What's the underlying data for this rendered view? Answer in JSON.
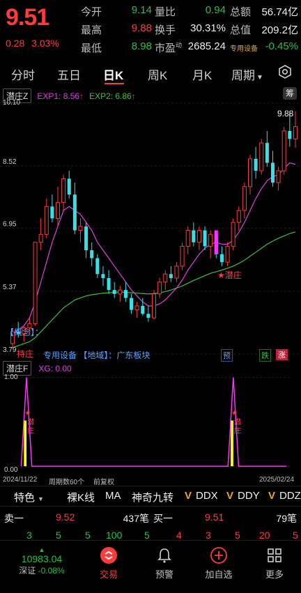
{
  "header": {
    "price": "9.51",
    "change": "0.28",
    "change_pct": "3.03%",
    "labels": {
      "open": "今开",
      "high": "最高",
      "low": "最低",
      "vol_ratio": "量比",
      "turnover": "换手",
      "pe": "市盈",
      "amount": "总额",
      "mkt_cap": "总值",
      "sector": "专用设备",
      "pe_sup": "动"
    },
    "values": {
      "open": "9.14",
      "high": "9.88",
      "low": "8.98",
      "vol_ratio": "0.94",
      "turnover": "30.31%",
      "pe": "2685.24",
      "amount": "56.74亿",
      "mkt_cap": "209.2亿",
      "sector_pct": "-0.45%"
    }
  },
  "tabs": [
    "分时",
    "五日",
    "日K",
    "周K",
    "月K",
    "周期"
  ],
  "indicator_main": {
    "name": "潜庄Z",
    "exp1": "EXP1: 8.56",
    "exp2": "EXP2: 6.86",
    "tag": "筹"
  },
  "main_chart": {
    "y_labels": [
      "10.10",
      "8.52",
      "6.95",
      "5.37",
      "3.79"
    ],
    "high_label": "9.88",
    "signal_label": "★潜庄",
    "concept_label": "【概念】：",
    "bottom_text": "专用设备 【地域】：广东板块",
    "left_bottom_text": "持庄",
    "badges": {
      "pre": "预",
      "green": "跌",
      "red": "涨"
    },
    "colors": {
      "up": "#ff3b3b",
      "down": "#35e0e6",
      "ma_fast": "#e040e0",
      "ma_slow": "#3fbf3f"
    }
  },
  "chart_data": {
    "type": "candlestick",
    "ylim": [
      3.79,
      10.1
    ],
    "candles": [
      [
        4.05,
        4.4,
        3.95,
        4.35
      ],
      [
        4.35,
        4.6,
        4.2,
        4.3
      ],
      [
        4.3,
        4.5,
        4.1,
        4.45
      ],
      [
        4.45,
        4.7,
        4.3,
        4.55
      ],
      [
        4.55,
        6.6,
        4.5,
        6.6
      ],
      [
        6.6,
        7.2,
        6.4,
        6.8
      ],
      [
        6.8,
        7.7,
        6.7,
        7.5
      ],
      [
        7.5,
        7.8,
        7.1,
        7.2
      ],
      [
        7.2,
        8.0,
        7.0,
        7.6
      ],
      [
        7.6,
        8.3,
        7.4,
        8.2
      ],
      [
        8.2,
        8.4,
        7.7,
        7.8
      ],
      [
        7.8,
        8.1,
        6.8,
        6.9
      ],
      [
        6.9,
        7.2,
        6.6,
        7.0
      ],
      [
        7.0,
        7.1,
        6.2,
        6.4
      ],
      [
        6.4,
        6.6,
        6.0,
        6.2
      ],
      [
        6.2,
        6.3,
        5.7,
        5.8
      ],
      [
        5.8,
        6.0,
        5.5,
        5.7
      ],
      [
        5.7,
        5.9,
        5.3,
        5.4
      ],
      [
        5.4,
        5.6,
        5.2,
        5.3
      ],
      [
        5.3,
        5.5,
        5.1,
        5.4
      ],
      [
        5.4,
        5.6,
        5.1,
        5.2
      ],
      [
        5.2,
        5.3,
        4.8,
        4.9
      ],
      [
        4.9,
        5.1,
        4.7,
        5.0
      ],
      [
        5.0,
        5.2,
        4.75,
        4.8
      ],
      [
        4.8,
        5.0,
        4.6,
        4.7
      ],
      [
        4.7,
        5.4,
        4.65,
        5.3
      ],
      [
        5.3,
        5.7,
        5.2,
        5.6
      ],
      [
        5.6,
        5.9,
        5.4,
        5.8
      ],
      [
        5.8,
        6.0,
        5.6,
        5.7
      ],
      [
        5.7,
        6.1,
        5.6,
        6.0
      ],
      [
        6.0,
        6.6,
        5.9,
        6.5
      ],
      [
        6.5,
        7.0,
        6.3,
        6.9
      ],
      [
        6.9,
        7.1,
        6.5,
        6.6
      ],
      [
        6.6,
        7.0,
        6.4,
        6.9
      ],
      [
        6.9,
        7.0,
        6.4,
        6.5
      ],
      [
        6.5,
        6.9,
        6.2,
        6.8
      ],
      [
        6.8,
        6.9,
        6.2,
        6.3
      ],
      [
        6.3,
        6.5,
        6.0,
        6.1
      ],
      [
        6.1,
        6.6,
        6.0,
        6.5
      ],
      [
        6.5,
        7.2,
        6.4,
        7.1
      ],
      [
        7.1,
        7.5,
        6.9,
        7.4
      ],
      [
        7.4,
        8.1,
        7.2,
        8.0
      ],
      [
        8.0,
        8.8,
        7.8,
        8.7
      ],
      [
        8.7,
        9.0,
        8.2,
        8.4
      ],
      [
        8.4,
        9.2,
        8.3,
        9.1
      ],
      [
        9.1,
        9.4,
        8.5,
        8.6
      ],
      [
        8.6,
        8.9,
        8.0,
        8.1
      ],
      [
        8.1,
        8.5,
        7.9,
        8.4
      ],
      [
        8.4,
        9.5,
        8.3,
        9.4
      ],
      [
        9.4,
        9.88,
        9.0,
        9.2
      ],
      [
        9.2,
        9.9,
        8.98,
        9.51
      ]
    ],
    "ma_fast": [
      4.3,
      4.4,
      4.5,
      4.7,
      5.1,
      5.6,
      6.1,
      6.6,
      7.0,
      7.4,
      7.5,
      7.4,
      7.3,
      7.1,
      6.9,
      6.6,
      6.4,
      6.2,
      6.0,
      5.8,
      5.6,
      5.4,
      5.25,
      5.1,
      5.0,
      5.0,
      5.05,
      5.15,
      5.3,
      5.45,
      5.65,
      5.9,
      6.1,
      6.3,
      6.45,
      6.55,
      6.6,
      6.55,
      6.55,
      6.65,
      6.85,
      7.1,
      7.4,
      7.7,
      7.95,
      8.15,
      8.25,
      8.3,
      8.45,
      8.6,
      8.56
    ],
    "ma_slow": [
      3.95,
      4.0,
      4.05,
      4.1,
      4.2,
      4.35,
      4.5,
      4.65,
      4.8,
      4.95,
      5.05,
      5.15,
      5.2,
      5.25,
      5.28,
      5.3,
      5.32,
      5.33,
      5.34,
      5.35,
      5.34,
      5.33,
      5.32,
      5.31,
      5.3,
      5.31,
      5.33,
      5.36,
      5.4,
      5.45,
      5.5,
      5.57,
      5.64,
      5.7,
      5.76,
      5.82,
      5.86,
      5.9,
      5.95,
      6.0,
      6.07,
      6.15,
      6.25,
      6.35,
      6.45,
      6.55,
      6.63,
      6.7,
      6.76,
      6.82,
      6.86
    ]
  },
  "indicator_sub": {
    "name": "潜庄F",
    "xg": "XG: 0.00",
    "y_labels": [
      "1.00",
      "0.00"
    ],
    "signal_text": "潜庄",
    "dates": {
      "start": "2024/11/22",
      "end": "2025/02/24"
    },
    "period_text": "周期数60个",
    "adjust_text": "前复权",
    "peaks": [
      1,
      40
    ]
  },
  "actions": {
    "special": "特色",
    "items": [
      "裸K线",
      "MA",
      "神奇九转",
      "DDX",
      "DDY",
      "DDZ"
    ]
  },
  "order_book": {
    "sell_label": "卖一",
    "sell_price": "9.52",
    "sell_vol": "437笔",
    "buy_label": "买一",
    "buy_price": "9.51",
    "buy_vol": "79笔"
  },
  "flow_row": {
    "green": [
      "3",
      "5",
      "5",
      "100",
      "5"
    ],
    "red": [
      "4",
      "3",
      "5",
      "20",
      "5"
    ]
  },
  "index": {
    "value": "10983.04",
    "name": "深证",
    "pct": "-0.08%"
  },
  "nav": [
    "交易",
    "预警",
    "加自选",
    "更多"
  ]
}
